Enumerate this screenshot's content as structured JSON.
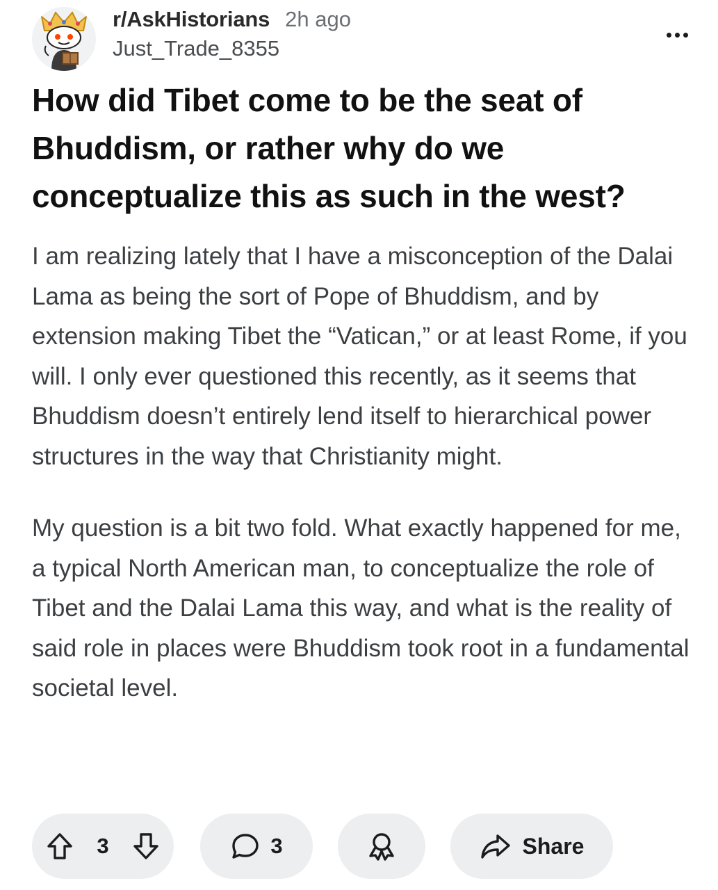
{
  "post": {
    "subreddit": "r/AskHistorians",
    "time_ago": "2h ago",
    "author": "Just_Trade_8355",
    "title": "How did Tibet come to be the seat of Bhuddism, or rather why do we conceptualize this as such in the west?",
    "body": [
      "I am realizing lately that I have a misconception of the Dalai Lama as being the sort of Pope of Bhuddism, and by extension making Tibet the “Vatican,” or at least Rome, if you will. I only ever questioned this recently, as it seems that Bhuddism doesn’t entirely lend itself to hierarchical power structures in the way that Christianity might.",
      "My question is a bit two fold. What exactly happened for me, a typical North American man, to conceptualize the role of Tibet and the Dalai Lama this way, and what is the reality of said role in places were Bhuddism took root in a fundamental societal level."
    ]
  },
  "actions": {
    "vote_count": "3",
    "comment_count": "3",
    "share_label": "Share"
  },
  "icons": {
    "avatar": "snoo-avatar-with-crown",
    "more": "more-options-icon",
    "upvote": "arrow-up-icon",
    "downvote": "arrow-down-icon",
    "comment": "comment-bubble-icon",
    "award": "award-icon",
    "share": "share-arrow-icon"
  },
  "colors": {
    "background": "#ffffff",
    "pill_background": "#eceef0",
    "title_text": "#111111",
    "body_text": "#3c3f42",
    "meta_text": "#6b6f73"
  }
}
